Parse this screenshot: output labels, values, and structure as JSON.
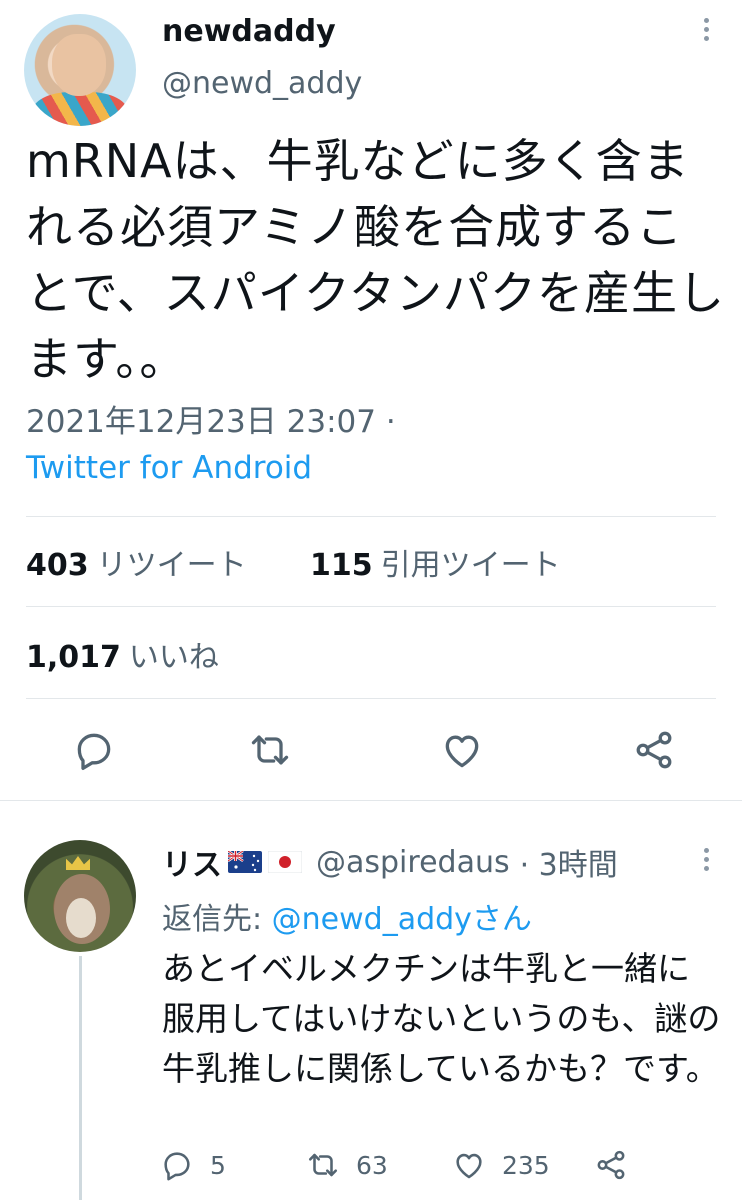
{
  "tweet": {
    "display_name": "newdaddy",
    "handle": "@newd_addy",
    "text": "mRNAは、牛乳などに多く含まれる必須アミノ酸を合成することで、スパイクタンパクを産生します。。",
    "timestamp": "2021年12月23日 23:07 ·",
    "source": "Twitter for Android",
    "stats": {
      "retweets_count": "403",
      "retweets_label": "リツイート",
      "quotes_count": "115",
      "quotes_label": "引用ツイート",
      "likes_count": "1,017",
      "likes_label": "いいね"
    },
    "actions": [
      "reply-icon",
      "retweet-icon",
      "like-icon",
      "share-icon"
    ]
  },
  "reply": {
    "display_name": "リス",
    "flags": [
      "australia-flag",
      "japan-flag"
    ],
    "handle": "@aspiredaus",
    "time": "· 3時間",
    "reply_to_label": "返信先: ",
    "reply_to_handle": "@newd_addyさん",
    "text": "あとイベルメクチンは牛乳と一緒に服用してはいけないというのも、謎の牛乳推しに関係しているかも？です。",
    "counts": {
      "replies": "5",
      "retweets": "63",
      "likes": "235"
    }
  },
  "colors": {
    "accent": "#1d9bf0",
    "secondary_text": "#536471",
    "primary_text": "#0f1419",
    "divider": "#e3e7ea"
  }
}
